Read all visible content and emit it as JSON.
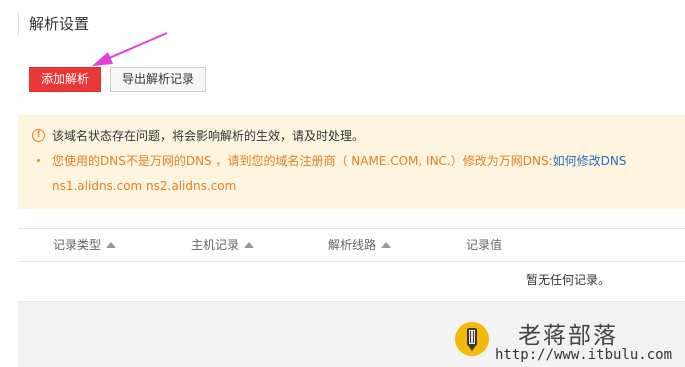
{
  "page_title": "解析设置",
  "toolbar": {
    "add_label": "添加解析",
    "export_label": "导出解析记录"
  },
  "notice": {
    "warning": "该域名状态存在问题，将会影响解析的生效，请及时处理。",
    "dns_message": "您使用的DNS不是万网的DNS ，请到您的域名注册商（ NAME.COM, INC.）修改为万网DNS:",
    "dns_link": "如何修改DNS",
    "nameservers": "ns1.alidns.com ns2.alidns.com"
  },
  "table": {
    "columns": [
      "记录类型",
      "主机记录",
      "解析线路",
      "记录值"
    ],
    "empty_text": "暂无任何记录。"
  },
  "watermark": {
    "name": "老蒋部落",
    "url": "http://www.itbulu.com"
  },
  "colors": {
    "primary_button": "#ea3838",
    "notice_background": "#fdf5df",
    "notice_highlight": "#e67e22",
    "link": "#2a6bc0",
    "annotation_arrow": "#e040d8"
  }
}
